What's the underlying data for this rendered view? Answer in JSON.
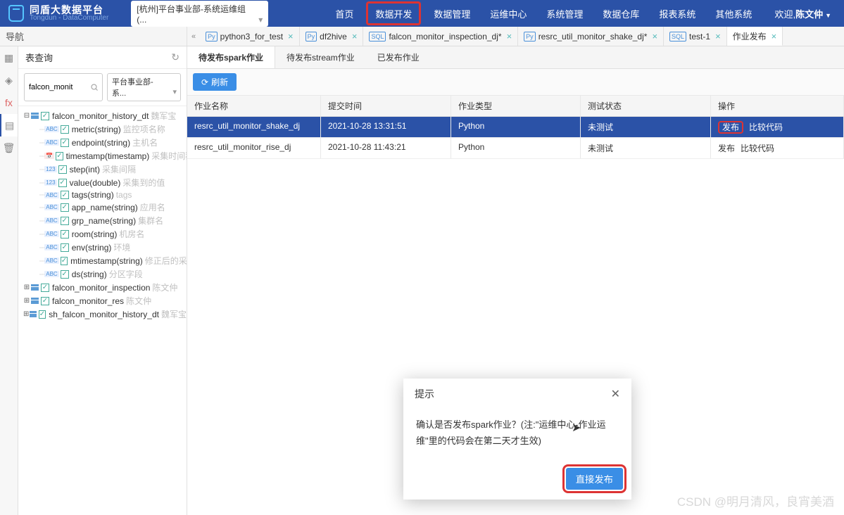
{
  "header": {
    "brand_main": "同盾大数据平台",
    "brand_sub": "Tongdun - DataComputer",
    "dept_selected": "[杭州]平台事业部-系统运维组(...",
    "welcome_prefix": "欢迎,",
    "user_name": "陈文仲",
    "nav": [
      "首页",
      "数据开发",
      "数据管理",
      "运维中心",
      "系统管理",
      "数据仓库",
      "报表系统",
      "其他系统"
    ]
  },
  "nav_panel_title": "导航",
  "file_tabs": [
    {
      "icon": "Py",
      "label": "python3_for_test"
    },
    {
      "icon": "Py",
      "label": "df2hive"
    },
    {
      "icon": "SQL",
      "label": "falcon_monitor_inspection_dj*"
    },
    {
      "icon": "Py",
      "label": "resrc_util_monitor_shake_dj*"
    },
    {
      "icon": "SQL",
      "label": "test-1"
    },
    {
      "icon": "",
      "label": "作业发布",
      "active": true
    }
  ],
  "sidebar": {
    "title": "表查询",
    "search_value": "falcon_monit",
    "scope_value": "平台事业部-系...",
    "tables": [
      {
        "name": "falcon_monitor_history_dt",
        "owner": "魏军宝",
        "expanded": true,
        "cols": [
          {
            "t": "ABC",
            "n": "metric(string)",
            "m": "监控项名称"
          },
          {
            "t": "ABC",
            "n": "endpoint(string)",
            "m": "主机名"
          },
          {
            "t": "DATE",
            "n": "timestamp(timestamp)",
            "m": "采集时间戳"
          },
          {
            "t": "123",
            "n": "step(int)",
            "m": "采集间隔"
          },
          {
            "t": "123",
            "n": "value(double)",
            "m": "采集到的值"
          },
          {
            "t": "ABC",
            "n": "tags(string)",
            "m": "tags"
          },
          {
            "t": "ABC",
            "n": "app_name(string)",
            "m": "应用名"
          },
          {
            "t": "ABC",
            "n": "grp_name(string)",
            "m": "集群名"
          },
          {
            "t": "ABC",
            "n": "room(string)",
            "m": "机房名"
          },
          {
            "t": "ABC",
            "n": "env(string)",
            "m": "环境"
          },
          {
            "t": "ABC",
            "n": "mtimestamp(string)",
            "m": "修正后的采集时"
          },
          {
            "t": "ABC",
            "n": "ds(string)",
            "m": "分区字段"
          }
        ]
      },
      {
        "name": "falcon_monitor_inspection",
        "owner": "陈文仲"
      },
      {
        "name": "falcon_monitor_res",
        "owner": "陈文仲"
      },
      {
        "name": "sh_falcon_monitor_history_dt",
        "owner": "魏军宝"
      }
    ]
  },
  "sub_tabs": [
    "待发布spark作业",
    "待发布stream作业",
    "已发布作业"
  ],
  "toolbar": {
    "refresh_label": "刷新"
  },
  "grid": {
    "cols": [
      "作业名称",
      "提交时间",
      "作业类型",
      "测试状态",
      "操作"
    ],
    "rows": [
      {
        "name": "resrc_util_monitor_shake_dj",
        "time": "2021-10-28 13:31:51",
        "type": "Python",
        "status": "未测试",
        "selected": true,
        "highlight_publish": true
      },
      {
        "name": "resrc_util_monitor_rise_dj",
        "time": "2021-10-28 11:43:21",
        "type": "Python",
        "status": "未测试"
      }
    ],
    "action_publish": "发布",
    "action_compare": "比较代码"
  },
  "modal": {
    "title": "提示",
    "message": "确认是否发布spark作业？(注:\"运维中心-作业运维\"里的代码会在第二天才生效)",
    "confirm_label": "直接发布"
  },
  "watermark": "CSDN @明月清风，良宵美酒"
}
